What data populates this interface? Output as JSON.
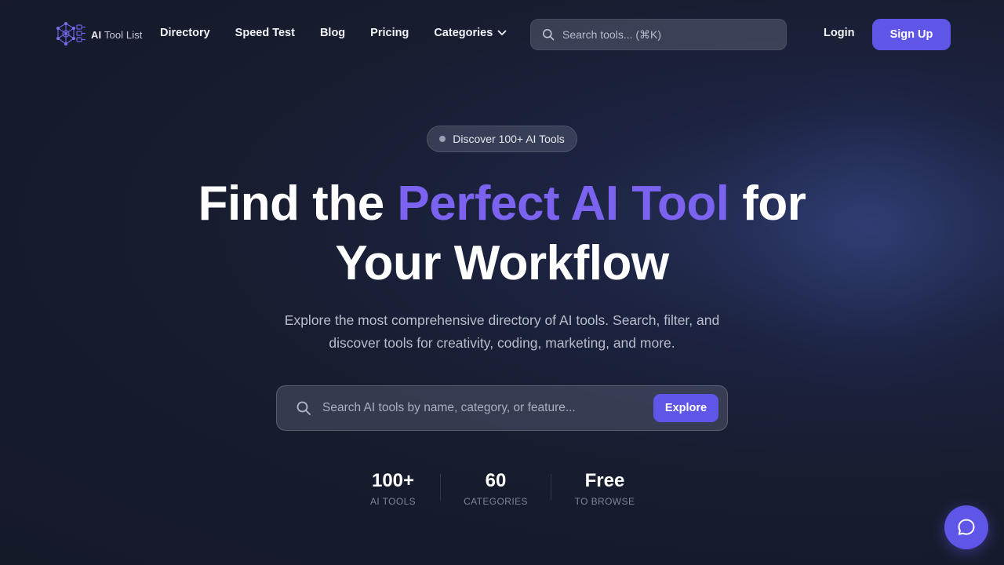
{
  "brand": {
    "name_strong": "AI",
    "name_rest": "Tool List"
  },
  "nav": {
    "links": [
      "Directory",
      "Speed Test",
      "Blog",
      "Pricing",
      "Categories"
    ],
    "search_placeholder": "Search tools... (⌘K)",
    "login": "Login",
    "signup": "Sign Up"
  },
  "hero": {
    "badge": "Discover 100+ AI Tools",
    "headline_pre": "Find the ",
    "headline_accent": "Perfect AI Tool",
    "headline_post": " for",
    "headline_line2": "Your Workflow",
    "subtitle": "Explore the most comprehensive directory of AI tools. Search, filter, and discover tools for creativity, coding, marketing, and more.",
    "search_placeholder": "Search AI tools by name, category, or feature...",
    "explore_label": "Explore"
  },
  "stats": [
    {
      "value": "100+",
      "label": "AI TOOLS"
    },
    {
      "value": "60",
      "label": "CATEGORIES"
    },
    {
      "value": "Free",
      "label": "TO BROWSE"
    }
  ],
  "colors": {
    "accent": "#7b63f0",
    "button": "#5f55e6",
    "background": "#171c2e"
  }
}
